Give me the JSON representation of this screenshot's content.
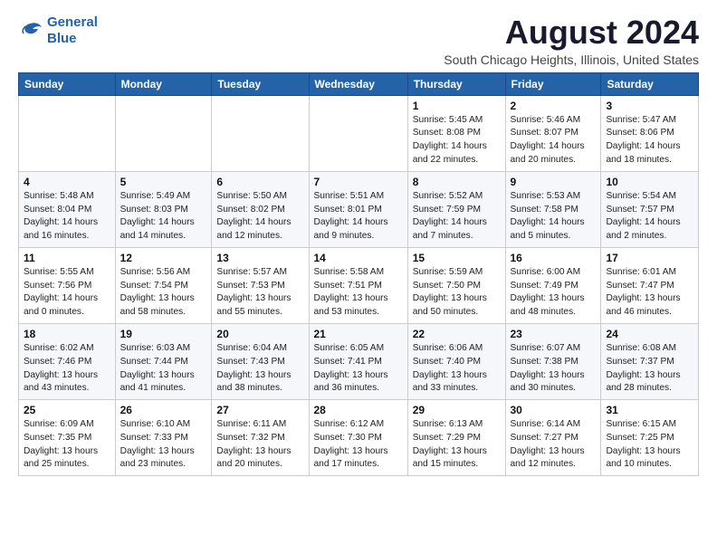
{
  "header": {
    "logo_line1": "General",
    "logo_line2": "Blue",
    "title": "August 2024",
    "subtitle": "South Chicago Heights, Illinois, United States"
  },
  "weekdays": [
    "Sunday",
    "Monday",
    "Tuesday",
    "Wednesday",
    "Thursday",
    "Friday",
    "Saturday"
  ],
  "weeks": [
    [
      {
        "day": "",
        "info": ""
      },
      {
        "day": "",
        "info": ""
      },
      {
        "day": "",
        "info": ""
      },
      {
        "day": "",
        "info": ""
      },
      {
        "day": "1",
        "info": "Sunrise: 5:45 AM\nSunset: 8:08 PM\nDaylight: 14 hours\nand 22 minutes."
      },
      {
        "day": "2",
        "info": "Sunrise: 5:46 AM\nSunset: 8:07 PM\nDaylight: 14 hours\nand 20 minutes."
      },
      {
        "day": "3",
        "info": "Sunrise: 5:47 AM\nSunset: 8:06 PM\nDaylight: 14 hours\nand 18 minutes."
      }
    ],
    [
      {
        "day": "4",
        "info": "Sunrise: 5:48 AM\nSunset: 8:04 PM\nDaylight: 14 hours\nand 16 minutes."
      },
      {
        "day": "5",
        "info": "Sunrise: 5:49 AM\nSunset: 8:03 PM\nDaylight: 14 hours\nand 14 minutes."
      },
      {
        "day": "6",
        "info": "Sunrise: 5:50 AM\nSunset: 8:02 PM\nDaylight: 14 hours\nand 12 minutes."
      },
      {
        "day": "7",
        "info": "Sunrise: 5:51 AM\nSunset: 8:01 PM\nDaylight: 14 hours\nand 9 minutes."
      },
      {
        "day": "8",
        "info": "Sunrise: 5:52 AM\nSunset: 7:59 PM\nDaylight: 14 hours\nand 7 minutes."
      },
      {
        "day": "9",
        "info": "Sunrise: 5:53 AM\nSunset: 7:58 PM\nDaylight: 14 hours\nand 5 minutes."
      },
      {
        "day": "10",
        "info": "Sunrise: 5:54 AM\nSunset: 7:57 PM\nDaylight: 14 hours\nand 2 minutes."
      }
    ],
    [
      {
        "day": "11",
        "info": "Sunrise: 5:55 AM\nSunset: 7:56 PM\nDaylight: 14 hours\nand 0 minutes."
      },
      {
        "day": "12",
        "info": "Sunrise: 5:56 AM\nSunset: 7:54 PM\nDaylight: 13 hours\nand 58 minutes."
      },
      {
        "day": "13",
        "info": "Sunrise: 5:57 AM\nSunset: 7:53 PM\nDaylight: 13 hours\nand 55 minutes."
      },
      {
        "day": "14",
        "info": "Sunrise: 5:58 AM\nSunset: 7:51 PM\nDaylight: 13 hours\nand 53 minutes."
      },
      {
        "day": "15",
        "info": "Sunrise: 5:59 AM\nSunset: 7:50 PM\nDaylight: 13 hours\nand 50 minutes."
      },
      {
        "day": "16",
        "info": "Sunrise: 6:00 AM\nSunset: 7:49 PM\nDaylight: 13 hours\nand 48 minutes."
      },
      {
        "day": "17",
        "info": "Sunrise: 6:01 AM\nSunset: 7:47 PM\nDaylight: 13 hours\nand 46 minutes."
      }
    ],
    [
      {
        "day": "18",
        "info": "Sunrise: 6:02 AM\nSunset: 7:46 PM\nDaylight: 13 hours\nand 43 minutes."
      },
      {
        "day": "19",
        "info": "Sunrise: 6:03 AM\nSunset: 7:44 PM\nDaylight: 13 hours\nand 41 minutes."
      },
      {
        "day": "20",
        "info": "Sunrise: 6:04 AM\nSunset: 7:43 PM\nDaylight: 13 hours\nand 38 minutes."
      },
      {
        "day": "21",
        "info": "Sunrise: 6:05 AM\nSunset: 7:41 PM\nDaylight: 13 hours\nand 36 minutes."
      },
      {
        "day": "22",
        "info": "Sunrise: 6:06 AM\nSunset: 7:40 PM\nDaylight: 13 hours\nand 33 minutes."
      },
      {
        "day": "23",
        "info": "Sunrise: 6:07 AM\nSunset: 7:38 PM\nDaylight: 13 hours\nand 30 minutes."
      },
      {
        "day": "24",
        "info": "Sunrise: 6:08 AM\nSunset: 7:37 PM\nDaylight: 13 hours\nand 28 minutes."
      }
    ],
    [
      {
        "day": "25",
        "info": "Sunrise: 6:09 AM\nSunset: 7:35 PM\nDaylight: 13 hours\nand 25 minutes."
      },
      {
        "day": "26",
        "info": "Sunrise: 6:10 AM\nSunset: 7:33 PM\nDaylight: 13 hours\nand 23 minutes."
      },
      {
        "day": "27",
        "info": "Sunrise: 6:11 AM\nSunset: 7:32 PM\nDaylight: 13 hours\nand 20 minutes."
      },
      {
        "day": "28",
        "info": "Sunrise: 6:12 AM\nSunset: 7:30 PM\nDaylight: 13 hours\nand 17 minutes."
      },
      {
        "day": "29",
        "info": "Sunrise: 6:13 AM\nSunset: 7:29 PM\nDaylight: 13 hours\nand 15 minutes."
      },
      {
        "day": "30",
        "info": "Sunrise: 6:14 AM\nSunset: 7:27 PM\nDaylight: 13 hours\nand 12 minutes."
      },
      {
        "day": "31",
        "info": "Sunrise: 6:15 AM\nSunset: 7:25 PM\nDaylight: 13 hours\nand 10 minutes."
      }
    ]
  ]
}
